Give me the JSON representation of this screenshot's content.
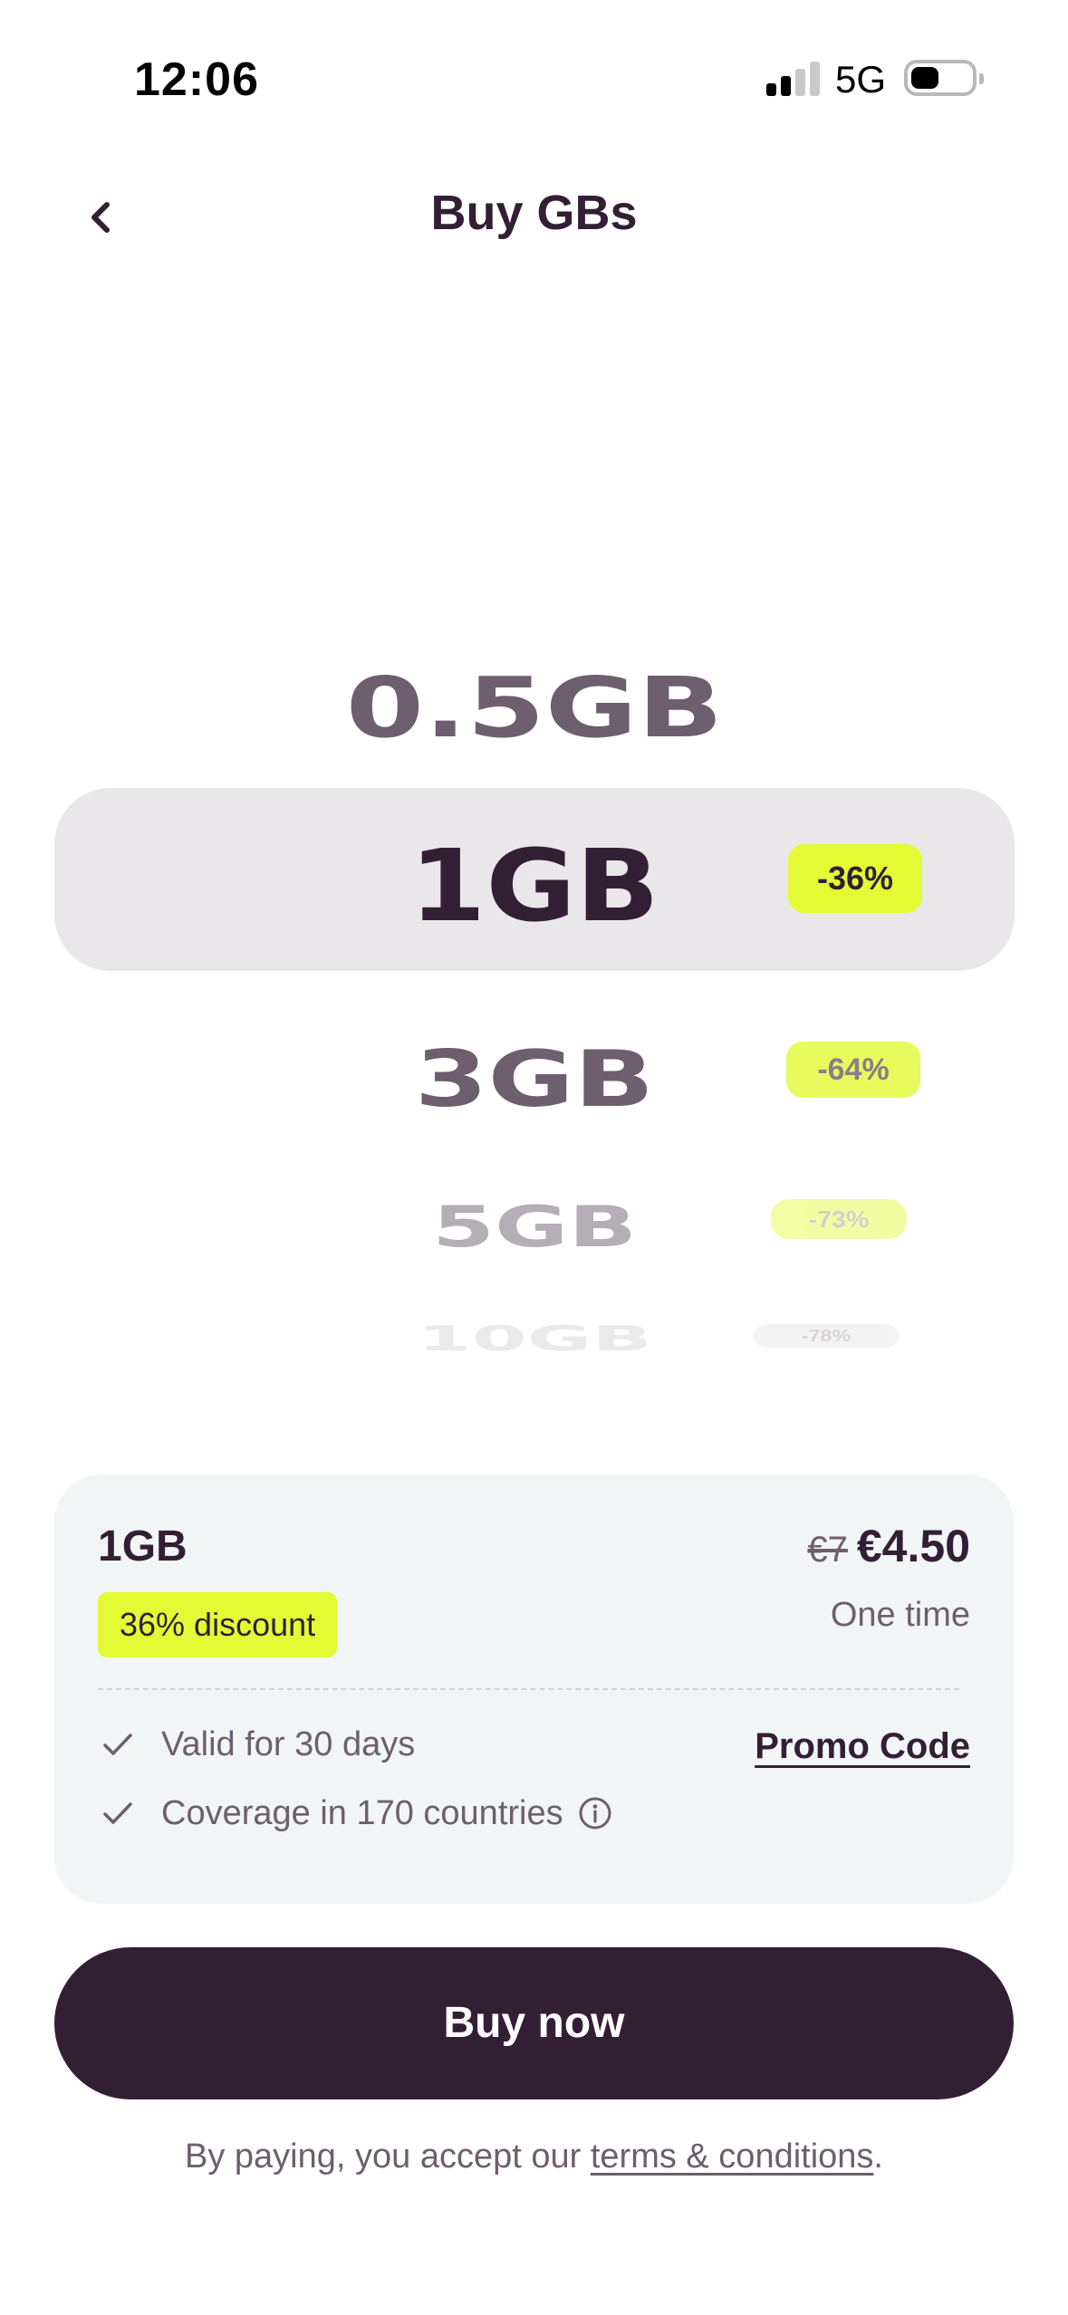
{
  "status_bar": {
    "time": "12:06",
    "network": "5G",
    "signal_icon": "signal-bars-icon",
    "battery_icon": "battery-icon"
  },
  "nav": {
    "back_icon": "chevron-left-icon",
    "title": "Buy GBs"
  },
  "picker": {
    "options": [
      {
        "label": "0.5GB",
        "discount": ""
      },
      {
        "label": "1GB",
        "discount": "-36%",
        "selected": true
      },
      {
        "label": "3GB",
        "discount": "-64%"
      },
      {
        "label": "5GB",
        "discount": "-73%"
      },
      {
        "label": "10GB",
        "discount": "-78%"
      }
    ]
  },
  "summary": {
    "plan": "1GB",
    "old_price": "€7",
    "price": "€4.50",
    "discount_badge": "36% discount",
    "frequency": "One time",
    "features": [
      {
        "icon": "check-icon",
        "text": "Valid for 30 days"
      },
      {
        "icon": "check-icon",
        "text": "Coverage in 170 countries",
        "trailing_icon": "info-icon"
      }
    ],
    "promo_label": "Promo Code"
  },
  "buy_button": {
    "label": "Buy now"
  },
  "terms": {
    "prefix": "By paying, you accept our ",
    "link": "terms & conditions",
    "suffix": "."
  },
  "colors": {
    "primary": "#331f33",
    "accent": "#e3fb35",
    "card_bg": "#f2f5f6",
    "selected_row_bg": "#e9e7ea",
    "muted_text": "#6d5f6d"
  }
}
